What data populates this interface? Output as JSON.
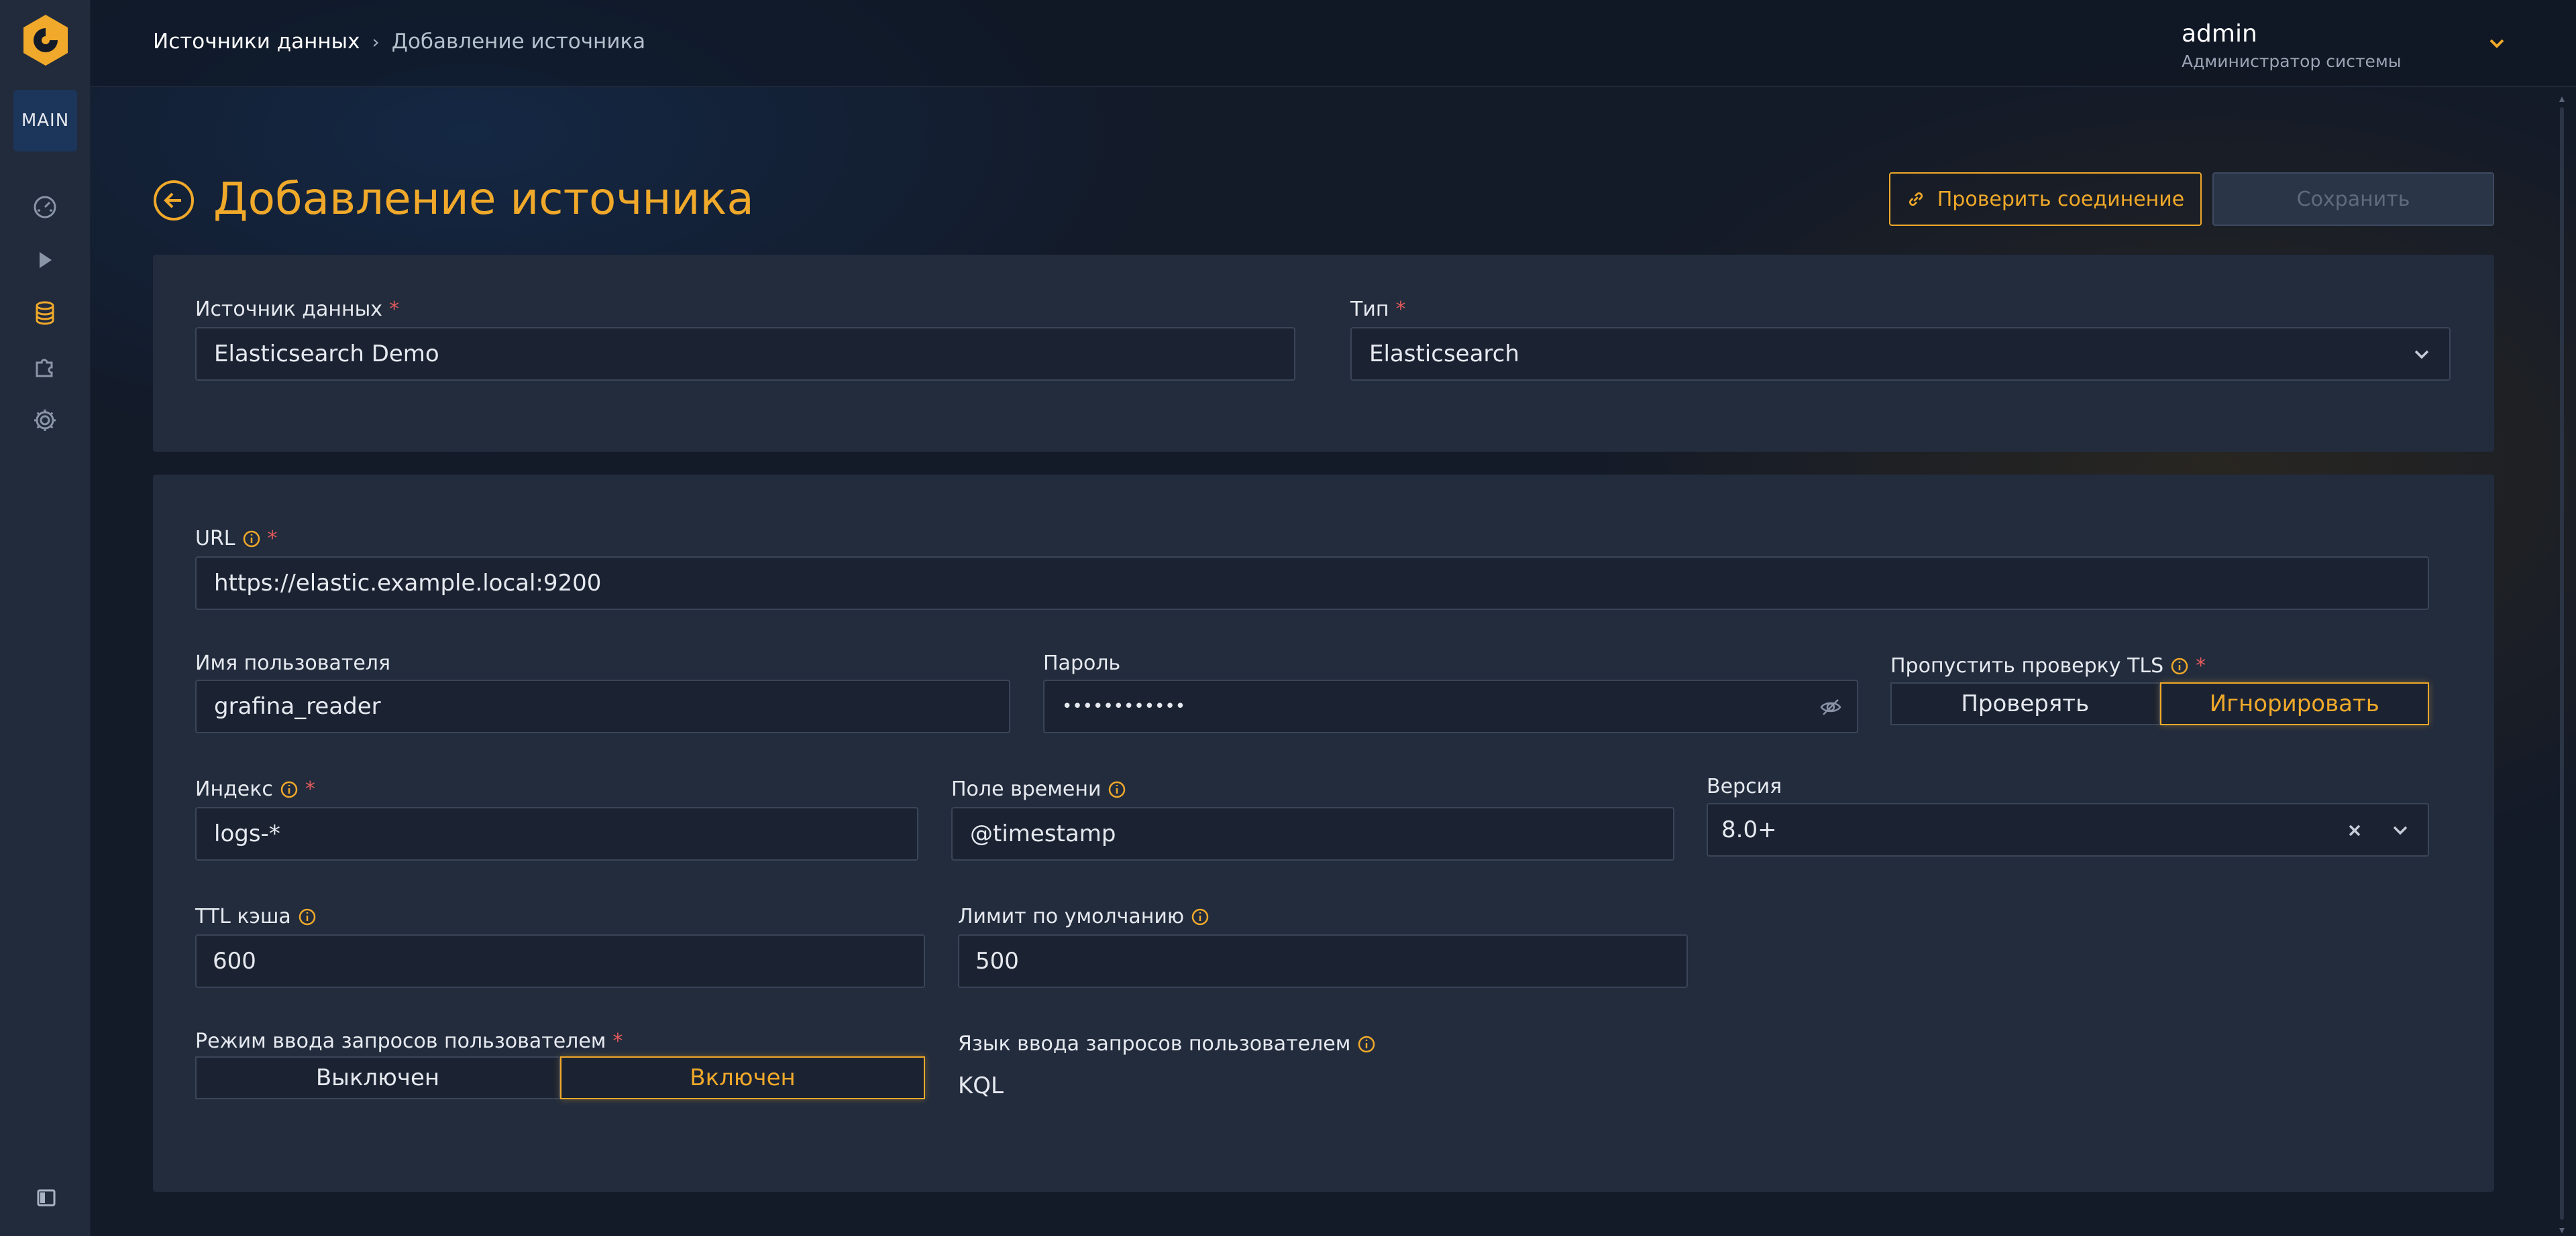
{
  "colors": {
    "accent": "#f0a92a",
    "sidebar_bg": "#222b3c",
    "panel_bg": "#222c3d",
    "input_bg": "#1b2333",
    "required": "#e25a5a",
    "main_badge_bg": "#1c355a"
  },
  "sidebar": {
    "badge": "MAIN",
    "items": [
      {
        "icon": "dashboard-gauge-icon"
      },
      {
        "icon": "play-icon"
      },
      {
        "icon": "database-icon",
        "active": true
      },
      {
        "icon": "puzzle-plugin-icon"
      },
      {
        "icon": "gear-icon"
      }
    ],
    "collapse_icon": "sidebar-toggle-icon"
  },
  "header": {
    "breadcrumb": {
      "root": "Источники данных",
      "separator": "›",
      "current": "Добавление источника"
    },
    "user": {
      "name": "admin",
      "role": "Администратор системы"
    }
  },
  "page": {
    "title": "Добавление источника",
    "check_button": "Проверить соединение",
    "save_button": "Сохранить"
  },
  "general": {
    "source_label": "Источник данных",
    "source_value": "Elasticsearch Demo",
    "type_label": "Тип",
    "type_value": "Elasticsearch"
  },
  "settings": {
    "url_label": "URL",
    "url_value": "https://elastic.example.local:9200",
    "username_label": "Имя пользователя",
    "username_value": "grafina_reader",
    "password_label": "Пароль",
    "password_value": "••••••••••••",
    "tls_label": "Пропустить проверку TLS",
    "tls_options": [
      "Проверять",
      "Игнорировать"
    ],
    "tls_selected": "Игнорировать",
    "index_label": "Индекс",
    "index_value": "logs-*",
    "timefield_label": "Поле времени",
    "timefield_value": "@timestamp",
    "version_label": "Версия",
    "version_value": "8.0+",
    "ttl_label": "TTL кэша",
    "ttl_value": "600",
    "limit_label": "Лимит по умолчанию",
    "limit_value": "500",
    "query_mode_label": "Режим ввода запросов пользователем",
    "query_mode_options": [
      "Выключен",
      "Включен"
    ],
    "query_mode_selected": "Включен",
    "query_lang_label": "Язык ввода запросов пользователем",
    "query_lang_value": "KQL"
  }
}
